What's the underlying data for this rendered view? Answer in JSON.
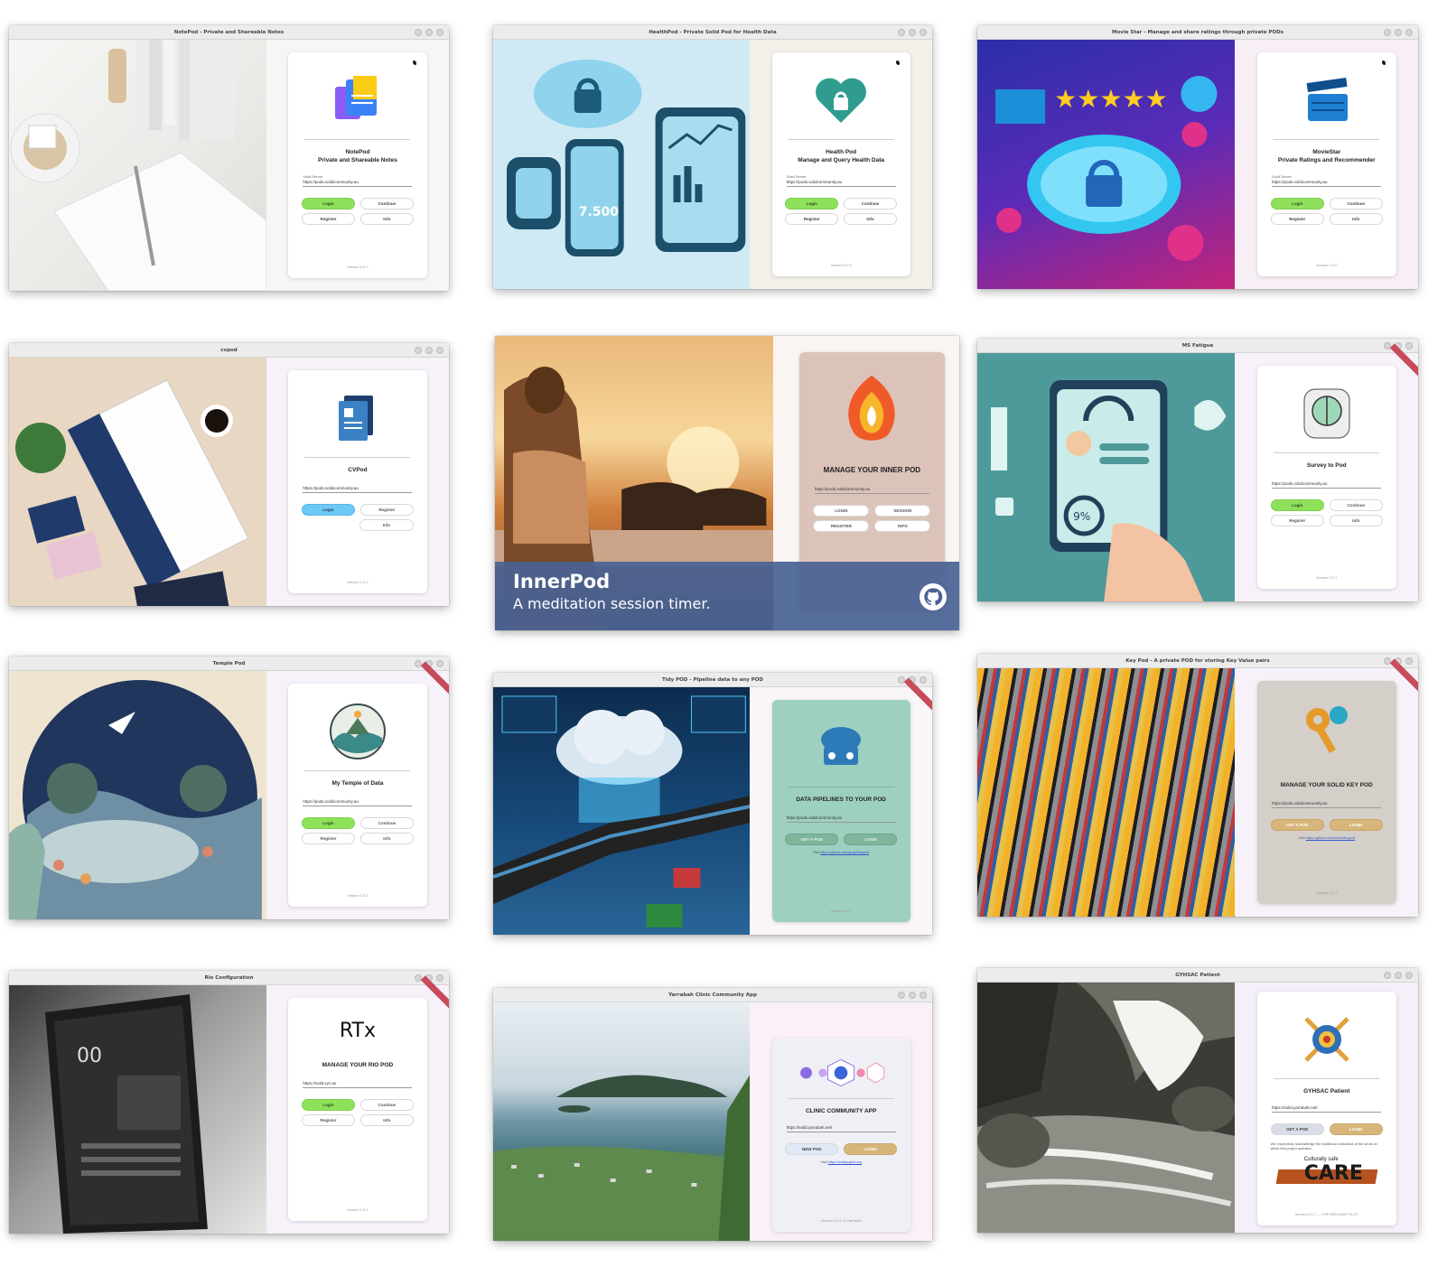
{
  "colors": {
    "login_green": "#8fe05a",
    "cv_blue": "#6ec8f5",
    "inner_banner": "#486294",
    "pane_lavender": "#f7f1fa"
  },
  "notepod": {
    "title": "NotePod - Private and Shareable Notes",
    "name": "NotePod",
    "subtitle": "Private and Shareable Notes",
    "field_label": "Solid Server",
    "url": "https://pods.solidcommunity.au",
    "login": "Login",
    "continue": "Continue",
    "register": "Register",
    "info": "Info",
    "version": "Version 0.0.7",
    "logo_icon": "notes-icon"
  },
  "healthpod": {
    "title": "HealthPod - Private Solid Pod for Health Data",
    "name": "Health Pod",
    "subtitle": "Manage and Query Health Data",
    "field_label": "Solid Server",
    "url": "https://pods.solidcommunity.au",
    "login": "Login",
    "continue": "Continue",
    "register": "Register",
    "info": "Info",
    "version": "Version 0.0.9",
    "logo_icon": "heart-lock-icon"
  },
  "moviestar": {
    "title": "Movie Star - Manage and share ratings through private PODs",
    "name": "MovieStar",
    "subtitle": "Private Ratings and Recommender",
    "field_label": "Solid Server",
    "url": "https://pods.solidcommunity.au",
    "login": "Login",
    "continue": "Continue",
    "register": "Register",
    "info": "Info",
    "version": "Version 1.0.0",
    "logo_icon": "clapperboard-icon"
  },
  "cvpod": {
    "title": "cvpod",
    "name": "CVPod",
    "url": "https://pods.solidcommunity.au",
    "login": "Login",
    "register": "Register",
    "info": "Info",
    "version": "Version 1.0.0",
    "logo_icon": "document-icon"
  },
  "innerpod": {
    "heading": "MANAGE YOUR INNER POD",
    "url": "https://pods.solidcommunity.au",
    "login": "LOGIN",
    "session": "SESSION",
    "register": "REGISTER",
    "info": "INFO",
    "banner_title": "InnerPod",
    "banner_subtitle": "A meditation session timer.",
    "logo_icon": "flame-icon"
  },
  "msfatigue": {
    "title": "MS Fatigue",
    "name": "Survey to Pod",
    "url": "https://pods.solidcommunity.au",
    "login": "Login",
    "continue": "Continue",
    "register": "Register",
    "info": "Info",
    "version": "Version 0.0.1",
    "logo_icon": "brain-icon"
  },
  "templepod": {
    "title": "Temple Pod",
    "name": "My Temple of Data",
    "url": "https://pods.solidcommunity.au",
    "login": "Login",
    "continue": "Continue",
    "register": "Register",
    "info": "Info",
    "version": "Version 0.0.1",
    "logo_icon": "wave-mountain-icon"
  },
  "tidypod": {
    "title": "Tidy POD - Pipeline data to any POD",
    "heading": "DATA PIPELINES TO YOUR POD",
    "url": "https://pods.solidcommunity.au",
    "getapod": "GET A POD",
    "login": "LOGIN",
    "visit_prefix": "Visit",
    "visit_link": "https://github.com/gjwgit/tidypod",
    "version": "Version 0.0.1",
    "logo_icon": "cloud-robot-icon"
  },
  "keypod": {
    "title": "Key Pod - A private POD for storing Key Value pairs",
    "heading": "MANAGE YOUR SOLID KEY POD",
    "url": "https://pods.solidcommunity.au",
    "getapod": "GET A POD",
    "login": "LOGIN",
    "visit_prefix": "Visit",
    "visit_link": "https://github.com/anusii/keypod",
    "version": "Version 0.0.1",
    "logo_icon": "key-icon"
  },
  "rio": {
    "title": "Rio Configuration",
    "brand": "RTx",
    "heading": "MANAGE YOUR RIO POD",
    "url": "https://solid.xyz.au",
    "login": "Login",
    "continue": "Continue",
    "register": "Register",
    "info": "Info",
    "version": "Version 0.0.1"
  },
  "yarrabah": {
    "title": "Yarrabah Clinic Community App",
    "heading": "CLINIC COMMUNITY APP",
    "url": "https://solid.yarrabah.net/",
    "newpod": "NEW POD",
    "login": "LOGIN",
    "visit_prefix": "Visit",
    "visit_link": "https://solidproject.org",
    "footer": "Version 0.0.1 of Yarrabah",
    "logo_icon": "network-icon"
  },
  "gyhsac": {
    "title": "GYHSAC Patient",
    "name": "GYHSAC Patient",
    "url": "https://solid.yarrabah.net/",
    "getapod": "GET A POD",
    "login": "LOGIN",
    "ack": "We respectfully acknowledge the traditional custodians of the lands on which this project operates.",
    "care_small": "Culturally safe",
    "care_big": "CARE",
    "version": "Version 0.0.7 — PRE-RELEASE PILOT",
    "logo_icon": "emblem-icon"
  }
}
